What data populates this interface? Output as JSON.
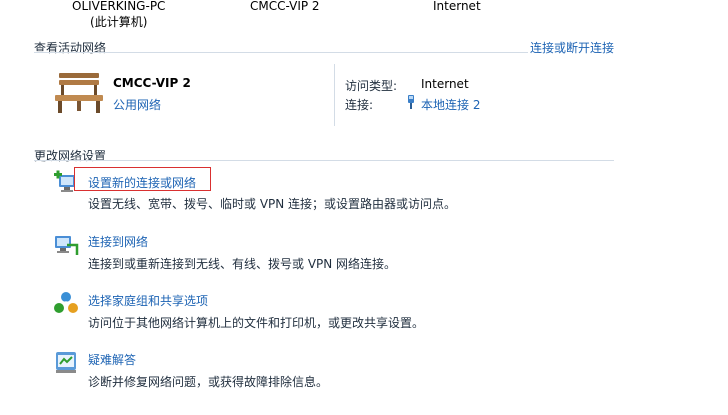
{
  "network_map": {
    "computer_name": "OLIVERKING-PC",
    "computer_note": "(此计算机)",
    "network_name": "CMCC-VIP  2",
    "internet_label": "Internet"
  },
  "active_networks": {
    "section_title": "查看活动网络",
    "connect_link": "连接或断开连接",
    "network": {
      "name": "CMCC-VIP  2",
      "type_link": "公用网络",
      "icon": "bench-icon"
    },
    "access_type_label": "访问类型:",
    "access_type_value": "Internet",
    "connection_label": "连接:",
    "connection_value": "本地连接 2"
  },
  "change_settings": {
    "section_title": "更改网络设置",
    "items": [
      {
        "title": "设置新的连接或网络",
        "desc": "设置无线、宽带、拨号、临时或 VPN 连接；或设置路由器或访问点。",
        "icon": "new-connection-icon"
      },
      {
        "title": "连接到网络",
        "desc": "连接到或重新连接到无线、有线、拨号或 VPN 网络连接。",
        "icon": "connect-network-icon"
      },
      {
        "title": "选择家庭组和共享选项",
        "desc": "访问位于其他网络计算机上的文件和打印机，或更改共享设置。",
        "icon": "homegroup-icon"
      },
      {
        "title": "疑难解答",
        "desc": "诊断并修复网络问题，或获得故障排除信息。",
        "icon": "troubleshoot-icon"
      }
    ]
  },
  "colors": {
    "link": "#1e64b4",
    "separator": "#d3dce6",
    "highlight": "#d93030"
  }
}
